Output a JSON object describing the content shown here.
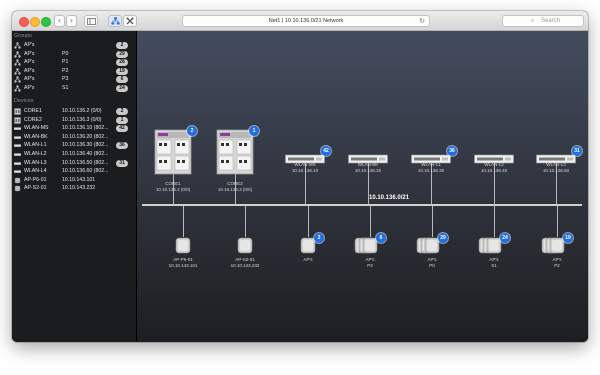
{
  "window": {
    "title": "Net1  |  10.10.136.0/21 Network",
    "search_placeholder": "Search"
  },
  "toolbar": {
    "back_glyph": "‹",
    "forward_glyph": "›",
    "sidebar_toggle_icon": "sidebar-icon",
    "network_view_icon": "network-map-icon",
    "tools_icon": "tools-icon"
  },
  "sidebar": {
    "groups_header": "Groups",
    "groups": [
      {
        "name": "AP's",
        "sub": "",
        "count": "2"
      },
      {
        "name": "AP's",
        "sub": "P0",
        "count": "29"
      },
      {
        "name": "AP's",
        "sub": "P1",
        "count": "28"
      },
      {
        "name": "AP's",
        "sub": "P2",
        "count": "19"
      },
      {
        "name": "AP's",
        "sub": "P3",
        "count": "6"
      },
      {
        "name": "AP's",
        "sub": "S1",
        "count": "24"
      }
    ],
    "devices_header": "Devices",
    "devices": [
      {
        "name": "CORE1",
        "address": "10.10.136.2 (0/0)",
        "count": "2",
        "icon": "chassis"
      },
      {
        "name": "CORE2",
        "address": "10.10.136.3 (0/0)",
        "count": "1",
        "icon": "chassis"
      },
      {
        "name": "WLAN-MS",
        "address": "10.10.136.10 (802...",
        "count": "42",
        "icon": "switch"
      },
      {
        "name": "WLAN-BK",
        "address": "10.10.136.20 (802...",
        "count": "",
        "icon": "switch"
      },
      {
        "name": "WLAN-L1",
        "address": "10.10.136.30 (802...",
        "count": "36",
        "icon": "switch"
      },
      {
        "name": "WLAN-L2",
        "address": "10.10.136.40 (802...",
        "count": "",
        "icon": "switch"
      },
      {
        "name": "WLAN-L3",
        "address": "10.10.136.50 (802...",
        "count": "31",
        "icon": "switch"
      },
      {
        "name": "WLAN-L4",
        "address": "10.10.136.60 (802...",
        "count": "",
        "icon": "switch"
      },
      {
        "name": "AP-P6-01",
        "address": "10.10.143.101",
        "count": "",
        "icon": "ap"
      },
      {
        "name": "AP-S2-01",
        "address": "10.10.143.232",
        "count": "",
        "icon": "ap"
      }
    ]
  },
  "network": {
    "label": "10.10.136.0/21",
    "cores": [
      {
        "name": "CORE1",
        "address": "10.10.136.2 (0/0)",
        "badge": "2"
      },
      {
        "name": "CORE2",
        "address": "10.10.136.3 (0/0)",
        "badge": "1"
      }
    ],
    "switches": [
      {
        "name": "WLAN-MS",
        "address": "10.10.136.10",
        "badge": "42"
      },
      {
        "name": "WLAN-BK",
        "address": "10.10.136.20",
        "badge": ""
      },
      {
        "name": "WLAN-L1",
        "address": "10.10.136.30",
        "badge": "36"
      },
      {
        "name": "WLAN-L2",
        "address": "10.10.136.40",
        "badge": ""
      },
      {
        "name": "WLAN-L3",
        "address": "10.10.136.50",
        "badge": "31"
      }
    ],
    "access_points": [
      {
        "name": "AP-P6-01",
        "sub": "10.10.143.101",
        "badge": "",
        "stacked": false
      },
      {
        "name": "AP-S2-01",
        "sub": "10.10.143.232",
        "badge": "",
        "stacked": false
      },
      {
        "name": "AP's",
        "sub": "",
        "badge": "2",
        "stacked": false
      },
      {
        "name": "AP's",
        "sub": "P3",
        "badge": "6",
        "stacked": true
      },
      {
        "name": "AP's",
        "sub": "P0",
        "badge": "29",
        "stacked": true
      },
      {
        "name": "AP's",
        "sub": "S1",
        "badge": "24",
        "stacked": true
      },
      {
        "name": "AP's",
        "sub": "P2",
        "badge": "19",
        "stacked": true
      }
    ]
  }
}
